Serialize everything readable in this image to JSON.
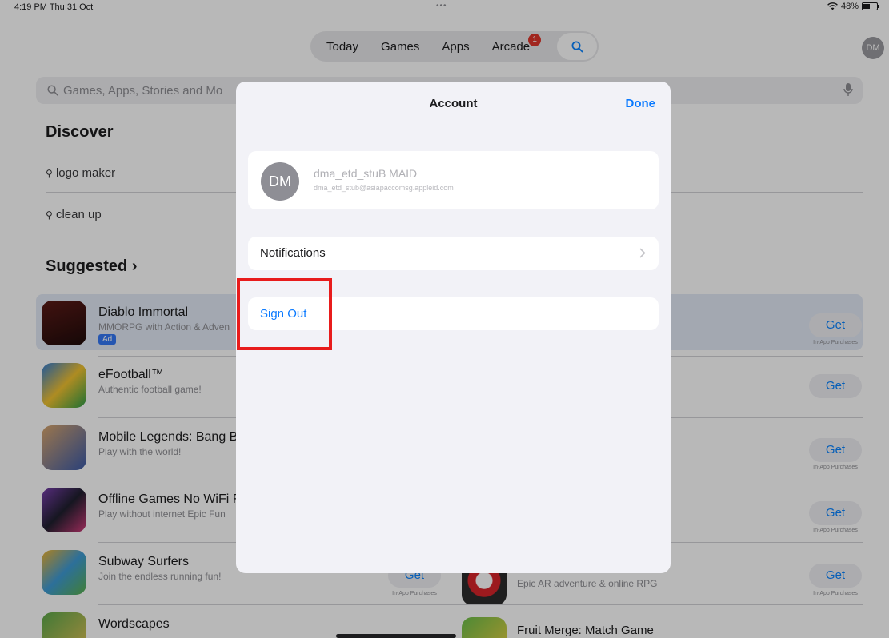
{
  "status": {
    "time": "4:19 PM  Thu 31 Oct",
    "dots": "•••",
    "battery": "48%"
  },
  "nav": {
    "tabs": [
      "Today",
      "Games",
      "Apps",
      "Arcade"
    ],
    "arcade_badge": "1",
    "avatar": "DM"
  },
  "search": {
    "placeholder": "Games, Apps, Stories and Mo"
  },
  "discover": {
    "title": "Discover",
    "items": [
      "logo maker",
      "clean up"
    ]
  },
  "suggested": {
    "title": "Suggested"
  },
  "apps": [
    {
      "name": "Diablo Immortal",
      "subtitle": "MMORPG with Action & Adven",
      "ad": "Ad",
      "get": "Get",
      "iap": "In-App Purchases"
    },
    {
      "name": "eFootball™",
      "subtitle": "Authentic football game!",
      "get": "Get"
    },
    {
      "name": "Mobile Legends: Bang B",
      "subtitle": "Play with the world!",
      "get": "Get",
      "iap": "In-App Purchases"
    },
    {
      "name": "Offline Games No WiFi F",
      "subtitle": "Play without internet Epic Fun",
      "get": "Get",
      "iap": "In-App Purchases"
    },
    {
      "name": "Subway Surfers",
      "subtitle": "Join the endless running fun!",
      "get": "Get",
      "iap": "In-App Purchases"
    },
    {
      "name": "Wordscapes"
    }
  ],
  "right_apps": [
    {
      "subtitle": "Epic AR adventure & online RPG",
      "get": "Get",
      "iap": "In-App Purchases"
    },
    {
      "name": "Fruit Merge: Match Game"
    }
  ],
  "modal": {
    "title": "Account",
    "done": "Done",
    "account": {
      "initials": "DM",
      "name": "dma_etd_stuB MAID",
      "email": "dma_etd_stub@asiapaccomsg.appleid.com"
    },
    "notifications": "Notifications",
    "sign_out": "Sign Out"
  },
  "colors": {
    "accent": "#0a7aff",
    "highlight": "#e81c1c"
  }
}
